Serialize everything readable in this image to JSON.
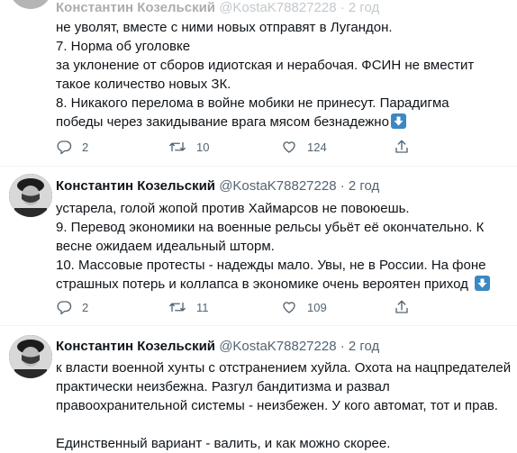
{
  "tweets": [
    {
      "author": {
        "name": "Константин Козельский",
        "handle": "@KostaK78827228",
        "time": "2 год"
      },
      "lines": [
        "не уволят, вместе с ними новых отправят в Лугандон.",
        "7. Норма об уголовке",
        "за уклонение от сборов идиотская и нерабочая. ФСИН не вместит",
        "такое количество новых ЗК.",
        "8. Никакого перелома в войне мобики не принесут. Парадигма",
        "победы через закидывание врага мясом безнадежно"
      ],
      "actions": {
        "replies": "2",
        "retweets": "10",
        "likes": "124"
      }
    },
    {
      "author": {
        "name": "Константин Козельский",
        "handle": "@KostaK78827228",
        "time": "2 год"
      },
      "lines": [
        "устарела, голой жопой против Хаймарсов не повоюешь.",
        "9. Перевод экономики на военные рельсы убьёт её окончательно. К",
        "весне ожидаем идеальный шторм.",
        "10. Массовые протесты - надежды мало. Увы, не в России. На фоне",
        "страшных потерь и коллапса в экономике очень вероятен приход"
      ],
      "actions": {
        "replies": "2",
        "retweets": "11",
        "likes": "109"
      }
    },
    {
      "author": {
        "name": "Константин Козельский",
        "handle": "@KostaK78827228",
        "time": "2 год"
      },
      "lines": [
        "к власти военной хунты с отстранением хуйла. Охота на нацпредателей",
        "практически неизбежна. Разгул бандитизма и развал",
        "правоохранительной системы - неизбежен. У кого автомат, тот и прав."
      ],
      "closing": "Единственный вариант - валить, и как можно скорее."
    }
  ],
  "colors": {
    "text": "#0f1419",
    "secondary": "#536471",
    "divider": "#eff3f4",
    "emoji": "#3b88c3"
  },
  "icons": [
    "reply-icon",
    "retweet-icon",
    "like-icon",
    "share-icon",
    "down-arrow-emoji"
  ]
}
